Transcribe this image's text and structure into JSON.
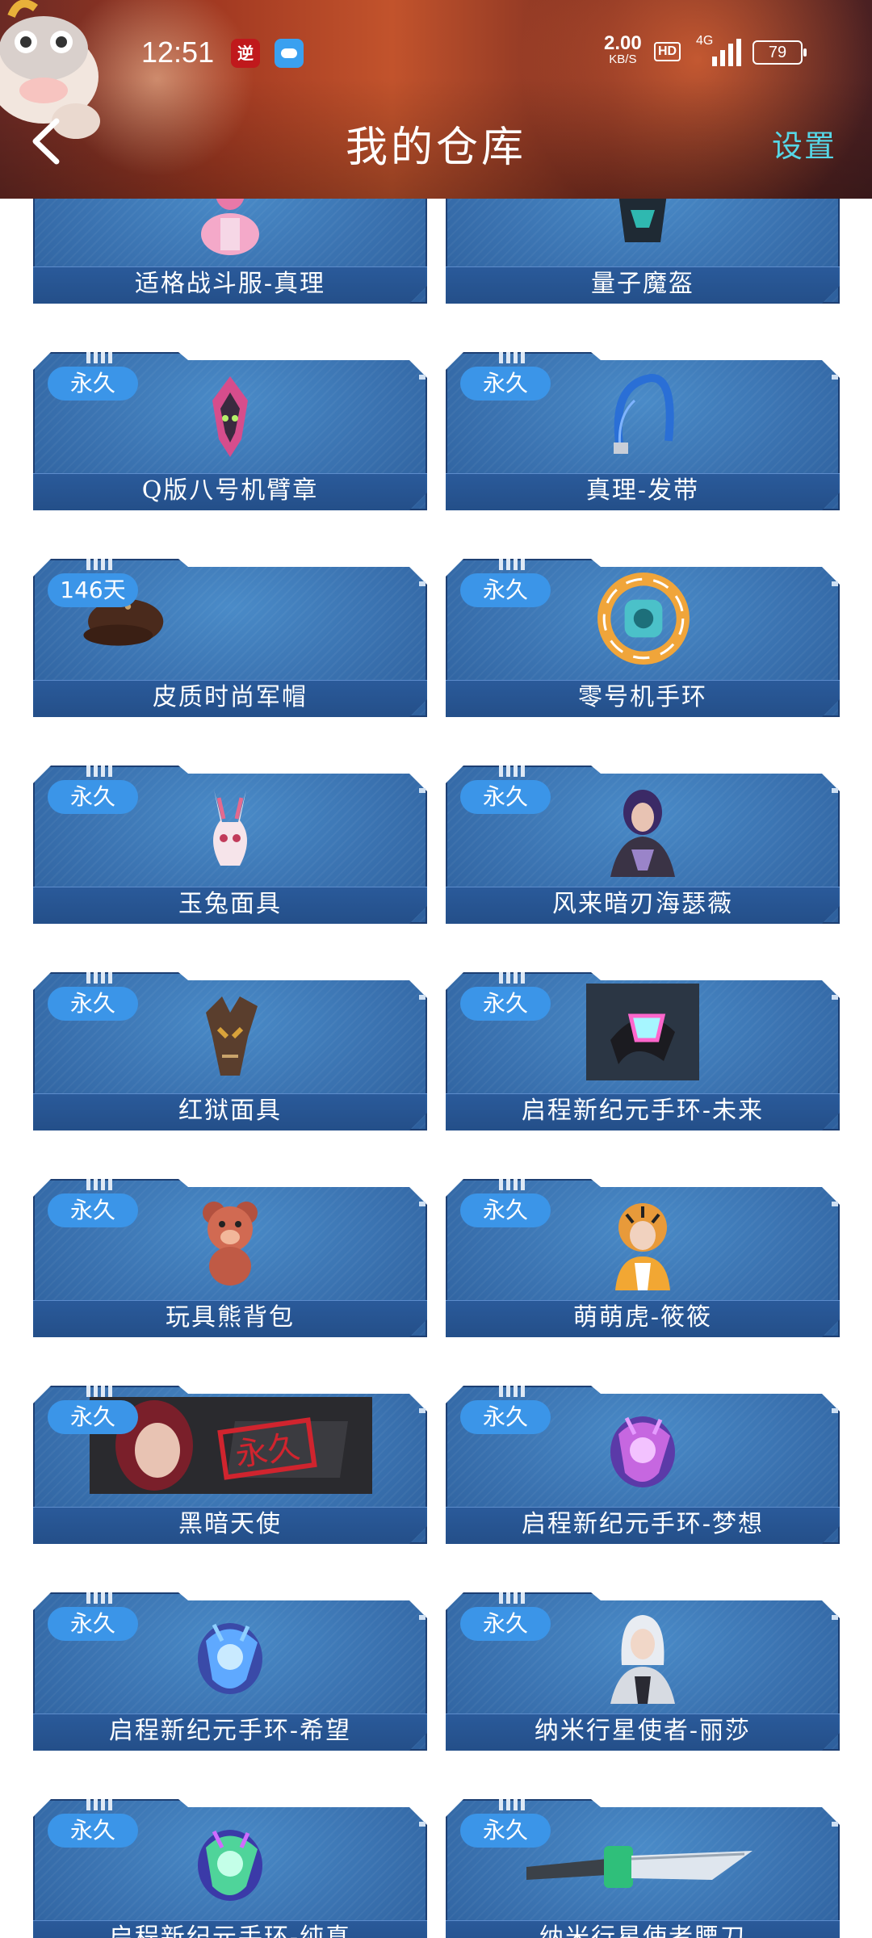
{
  "status_bar": {
    "time": "12:51",
    "network_speed": "2.00",
    "network_unit": "KB/S",
    "hd_label": "HD",
    "signal_type": "4G",
    "battery": "79"
  },
  "header": {
    "title": "我的仓库",
    "settings_label": "设置"
  },
  "colors": {
    "card_blue": "#3a72b0",
    "badge_blue": "#3b95e8",
    "settings_cyan": "#56d6e6"
  },
  "items": [
    {
      "name": "适格战斗服-真理",
      "badge": "",
      "icon": "pink-suit-character-icon"
    },
    {
      "name": "量子魔盔",
      "badge": "",
      "icon": "dark-helmet-icon"
    },
    {
      "name": "Q版八号机臂章",
      "badge": "永久",
      "icon": "pink-armband-icon"
    },
    {
      "name": "真理-发带",
      "badge": "永久",
      "icon": "blue-headband-icon"
    },
    {
      "name": "皮质时尚军帽",
      "badge": "146天",
      "icon": "leather-cap-icon"
    },
    {
      "name": "零号机手环",
      "badge": "永久",
      "icon": "orange-bracelet-icon"
    },
    {
      "name": "玉兔面具",
      "badge": "永久",
      "icon": "rabbit-mask-icon"
    },
    {
      "name": "风来暗刃海瑟薇",
      "badge": "永久",
      "icon": "purple-hair-character-icon"
    },
    {
      "name": "红狱面具",
      "badge": "永久",
      "icon": "demon-mask-icon"
    },
    {
      "name": "启程新纪元手环-未来",
      "badge": "永久",
      "icon": "future-bracelet-icon"
    },
    {
      "name": "玩具熊背包",
      "badge": "永久",
      "icon": "teddy-bear-backpack-icon"
    },
    {
      "name": "萌萌虎-筱筱",
      "badge": "永久",
      "icon": "tiger-hood-character-icon"
    },
    {
      "name": "黑暗天使",
      "badge": "永久",
      "icon": "dark-angel-banner-icon",
      "stamp": "永久"
    },
    {
      "name": "启程新纪元手环-梦想",
      "badge": "永久",
      "icon": "purple-bracelet-icon"
    },
    {
      "name": "启程新纪元手环-希望",
      "badge": "永久",
      "icon": "blue-bracelet-icon"
    },
    {
      "name": "纳米行星使者-丽莎",
      "badge": "永久",
      "icon": "white-hair-character-icon"
    },
    {
      "name": "启程新纪元手环-纯真",
      "badge": "永久",
      "icon": "green-bracelet-icon"
    },
    {
      "name": "纳米行星使者腰刀",
      "badge": "永久",
      "icon": "knife-icon"
    }
  ]
}
